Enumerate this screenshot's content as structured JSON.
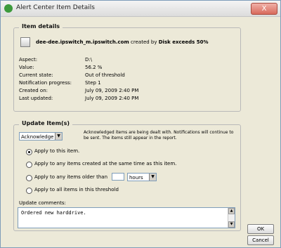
{
  "window": {
    "title": "Alert Center Item Details",
    "close_label": "X"
  },
  "item_details": {
    "legend": "Item details",
    "item_name": "dee-dee.ipswitch_m.ipswitch.com",
    "created_by_text": "created by",
    "rule_name": "Disk exceeds 50%",
    "fields": [
      {
        "label": "Aspect:",
        "value": "D:\\"
      },
      {
        "label": "Value:",
        "value": "56.2 %"
      },
      {
        "label": "Current state:",
        "value": "Out of threshold"
      },
      {
        "label": "Notification progress:",
        "value": "Step 1"
      },
      {
        "label": "Created on:",
        "value": "July 09, 2009 2:40 PM"
      },
      {
        "label": "Last updated:",
        "value": "July 09, 2009 2:40 PM"
      }
    ]
  },
  "update_items": {
    "legend": "Update Item(s)",
    "action_select": "Acknowledge",
    "note": "Acknowledged items are being dealt with. Notifications will continue to be sent. The items still appear in the report.",
    "options": [
      {
        "label": "Apply to this item.",
        "checked": true
      },
      {
        "label": "Apply to any items created at the same time as this item.",
        "checked": false
      },
      {
        "label": "Apply to any items older than",
        "checked": false
      },
      {
        "label": "Apply to all items in this threshold",
        "checked": false
      }
    ],
    "age_value": "",
    "age_unit": "hours",
    "comments_label": "Update comments:",
    "comments_value": "Ordered new harddrive."
  },
  "buttons": {
    "ok": "OK",
    "cancel": "Cancel"
  }
}
